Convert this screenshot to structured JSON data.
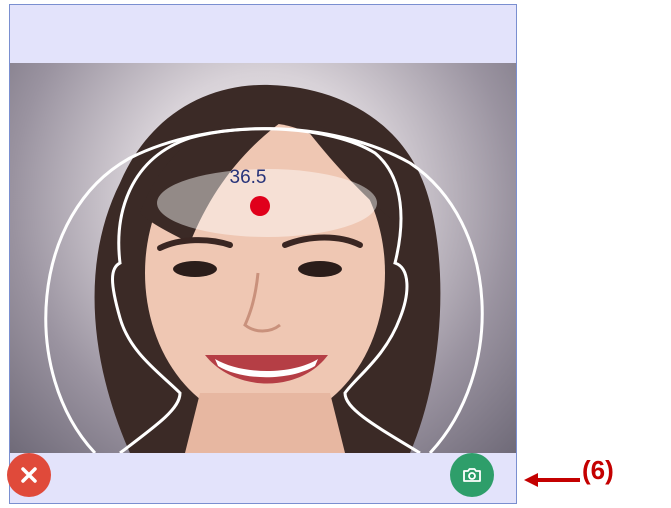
{
  "overlay": {
    "temperature": "36.5"
  },
  "buttons": {
    "cancel_icon": "close-icon",
    "capture_icon": "camera-icon"
  },
  "annotation": {
    "label": "(6)"
  },
  "colors": {
    "cancel": "#e04a3a",
    "capture": "#2e9e6a",
    "annotation": "#c40000",
    "measure_dot": "#e0001b"
  }
}
